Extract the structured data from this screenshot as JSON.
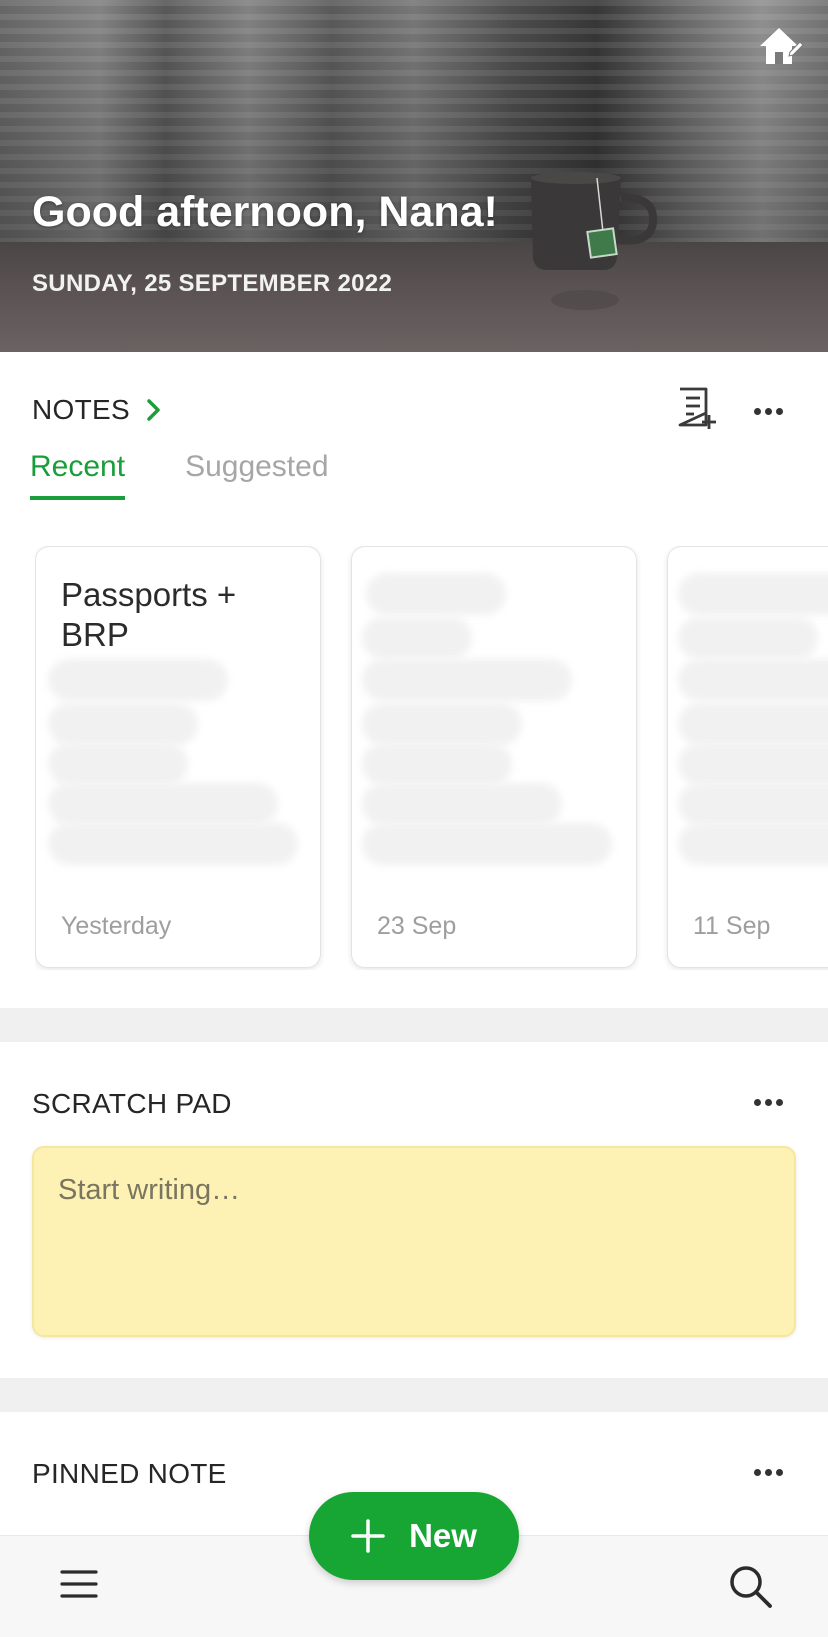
{
  "hero": {
    "greeting": "Good afternoon, Nana!",
    "date": "SUNDAY, 25 SEPTEMBER 2022",
    "edit_icon": "home-edit-icon"
  },
  "notes": {
    "title": "NOTES",
    "tabs": [
      {
        "label": "Recent",
        "active": true
      },
      {
        "label": "Suggested",
        "active": false
      }
    ],
    "cards": [
      {
        "title": "Passports + BRP",
        "date": "Yesterday"
      },
      {
        "title": "",
        "date": "23 Sep"
      },
      {
        "title": "",
        "date": "11 Sep"
      }
    ]
  },
  "scratch_pad": {
    "title": "SCRATCH PAD",
    "placeholder": "Start writing…"
  },
  "pinned_note": {
    "title": "PINNED NOTE"
  },
  "fab": {
    "label": "New"
  },
  "colors": {
    "accent": "#1a9e3a",
    "scratch_bg": "#fdf2b3"
  }
}
